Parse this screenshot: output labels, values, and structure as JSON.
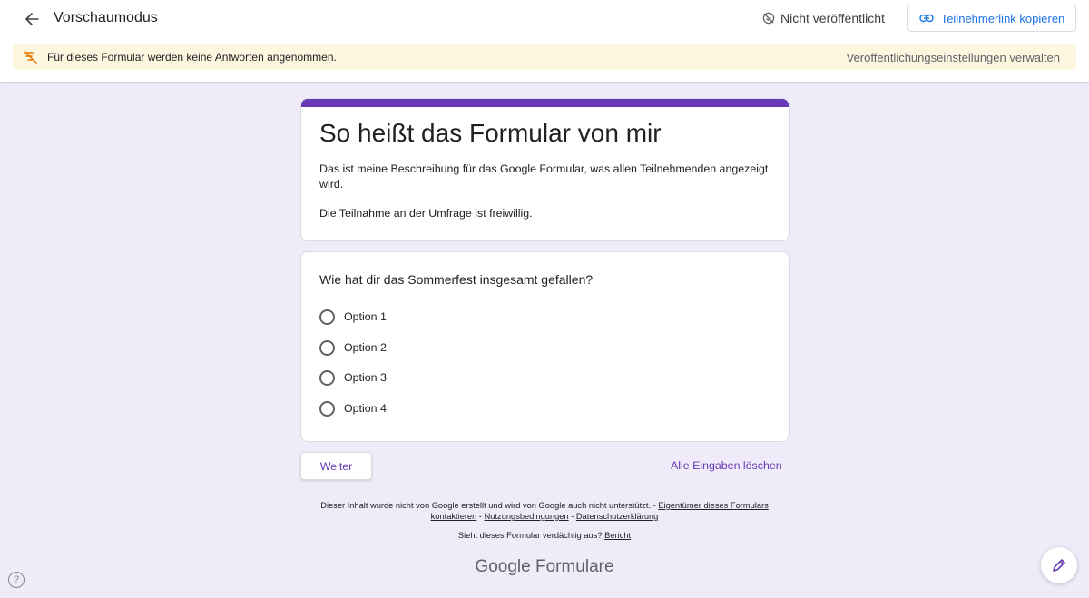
{
  "header": {
    "title": "Vorschaumodus",
    "status": "Nicht veröffentlicht",
    "copy_link_label": "Teilnehmerlink kopieren"
  },
  "banner": {
    "text": "Für dieses Formular werden keine Antworten angenommen.",
    "link": "Veröffentlichungseinstellungen verwalten"
  },
  "form": {
    "title": "So heißt das Formular von mir",
    "description": "Das ist meine Beschreibung für das Google Formular, was allen Teilnehmenden angezeigt wird.",
    "note": "Die Teilnahme an der Umfrage ist freiwillig.",
    "question": {
      "text": "Wie hat dir das Sommerfest insgesamt gefallen?",
      "options": [
        "Option 1",
        "Option 2",
        "Option 3",
        "Option 4"
      ]
    },
    "next_label": "Weiter",
    "clear_label": "Alle Eingaben löschen"
  },
  "footer": {
    "disclaimer": "Dieser Inhalt wurde nicht von Google erstellt und wird von Google auch nicht unterstützt. - ",
    "contact_link": "Eigentümer dieses Formulars kontaktieren",
    "sep1": " - ",
    "terms_link": "Nutzungsbedingungen",
    "sep2": " - ",
    "privacy_link": "Datenschutzerklärung",
    "suspicious": "Sieht dieses Formular verdächtig aus? ",
    "report_link": "Bericht",
    "brand_google": "Google",
    "brand_product": " Formulare"
  },
  "colors": {
    "accent": "#673ab7",
    "background": "#f0ebf8",
    "link_blue": "#1a73e8",
    "banner_bg": "#fef7e0"
  },
  "icons": {
    "back": "arrow-back-icon",
    "unpublished": "unpublished-icon",
    "link": "link-icon",
    "banner": "no-responses-icon",
    "help": "help-icon",
    "edit": "pencil-icon"
  }
}
